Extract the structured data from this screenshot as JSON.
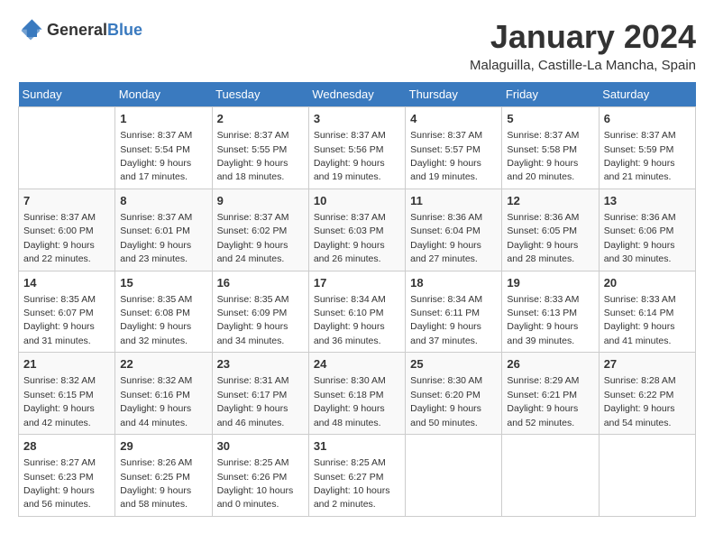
{
  "header": {
    "logo_line1": "General",
    "logo_line2": "Blue",
    "title": "January 2024",
    "subtitle": "Malaguilla, Castille-La Mancha, Spain"
  },
  "weekdays": [
    "Sunday",
    "Monday",
    "Tuesday",
    "Wednesday",
    "Thursday",
    "Friday",
    "Saturday"
  ],
  "weeks": [
    [
      {
        "day": "",
        "sunrise": "",
        "sunset": "",
        "daylight": ""
      },
      {
        "day": "1",
        "sunrise": "Sunrise: 8:37 AM",
        "sunset": "Sunset: 5:54 PM",
        "daylight": "Daylight: 9 hours and 17 minutes."
      },
      {
        "day": "2",
        "sunrise": "Sunrise: 8:37 AM",
        "sunset": "Sunset: 5:55 PM",
        "daylight": "Daylight: 9 hours and 18 minutes."
      },
      {
        "day": "3",
        "sunrise": "Sunrise: 8:37 AM",
        "sunset": "Sunset: 5:56 PM",
        "daylight": "Daylight: 9 hours and 19 minutes."
      },
      {
        "day": "4",
        "sunrise": "Sunrise: 8:37 AM",
        "sunset": "Sunset: 5:57 PM",
        "daylight": "Daylight: 9 hours and 19 minutes."
      },
      {
        "day": "5",
        "sunrise": "Sunrise: 8:37 AM",
        "sunset": "Sunset: 5:58 PM",
        "daylight": "Daylight: 9 hours and 20 minutes."
      },
      {
        "day": "6",
        "sunrise": "Sunrise: 8:37 AM",
        "sunset": "Sunset: 5:59 PM",
        "daylight": "Daylight: 9 hours and 21 minutes."
      }
    ],
    [
      {
        "day": "7",
        "sunrise": "Sunrise: 8:37 AM",
        "sunset": "Sunset: 6:00 PM",
        "daylight": "Daylight: 9 hours and 22 minutes."
      },
      {
        "day": "8",
        "sunrise": "Sunrise: 8:37 AM",
        "sunset": "Sunset: 6:01 PM",
        "daylight": "Daylight: 9 hours and 23 minutes."
      },
      {
        "day": "9",
        "sunrise": "Sunrise: 8:37 AM",
        "sunset": "Sunset: 6:02 PM",
        "daylight": "Daylight: 9 hours and 24 minutes."
      },
      {
        "day": "10",
        "sunrise": "Sunrise: 8:37 AM",
        "sunset": "Sunset: 6:03 PM",
        "daylight": "Daylight: 9 hours and 26 minutes."
      },
      {
        "day": "11",
        "sunrise": "Sunrise: 8:36 AM",
        "sunset": "Sunset: 6:04 PM",
        "daylight": "Daylight: 9 hours and 27 minutes."
      },
      {
        "day": "12",
        "sunrise": "Sunrise: 8:36 AM",
        "sunset": "Sunset: 6:05 PM",
        "daylight": "Daylight: 9 hours and 28 minutes."
      },
      {
        "day": "13",
        "sunrise": "Sunrise: 8:36 AM",
        "sunset": "Sunset: 6:06 PM",
        "daylight": "Daylight: 9 hours and 30 minutes."
      }
    ],
    [
      {
        "day": "14",
        "sunrise": "Sunrise: 8:35 AM",
        "sunset": "Sunset: 6:07 PM",
        "daylight": "Daylight: 9 hours and 31 minutes."
      },
      {
        "day": "15",
        "sunrise": "Sunrise: 8:35 AM",
        "sunset": "Sunset: 6:08 PM",
        "daylight": "Daylight: 9 hours and 32 minutes."
      },
      {
        "day": "16",
        "sunrise": "Sunrise: 8:35 AM",
        "sunset": "Sunset: 6:09 PM",
        "daylight": "Daylight: 9 hours and 34 minutes."
      },
      {
        "day": "17",
        "sunrise": "Sunrise: 8:34 AM",
        "sunset": "Sunset: 6:10 PM",
        "daylight": "Daylight: 9 hours and 36 minutes."
      },
      {
        "day": "18",
        "sunrise": "Sunrise: 8:34 AM",
        "sunset": "Sunset: 6:11 PM",
        "daylight": "Daylight: 9 hours and 37 minutes."
      },
      {
        "day": "19",
        "sunrise": "Sunrise: 8:33 AM",
        "sunset": "Sunset: 6:13 PM",
        "daylight": "Daylight: 9 hours and 39 minutes."
      },
      {
        "day": "20",
        "sunrise": "Sunrise: 8:33 AM",
        "sunset": "Sunset: 6:14 PM",
        "daylight": "Daylight: 9 hours and 41 minutes."
      }
    ],
    [
      {
        "day": "21",
        "sunrise": "Sunrise: 8:32 AM",
        "sunset": "Sunset: 6:15 PM",
        "daylight": "Daylight: 9 hours and 42 minutes."
      },
      {
        "day": "22",
        "sunrise": "Sunrise: 8:32 AM",
        "sunset": "Sunset: 6:16 PM",
        "daylight": "Daylight: 9 hours and 44 minutes."
      },
      {
        "day": "23",
        "sunrise": "Sunrise: 8:31 AM",
        "sunset": "Sunset: 6:17 PM",
        "daylight": "Daylight: 9 hours and 46 minutes."
      },
      {
        "day": "24",
        "sunrise": "Sunrise: 8:30 AM",
        "sunset": "Sunset: 6:18 PM",
        "daylight": "Daylight: 9 hours and 48 minutes."
      },
      {
        "day": "25",
        "sunrise": "Sunrise: 8:30 AM",
        "sunset": "Sunset: 6:20 PM",
        "daylight": "Daylight: 9 hours and 50 minutes."
      },
      {
        "day": "26",
        "sunrise": "Sunrise: 8:29 AM",
        "sunset": "Sunset: 6:21 PM",
        "daylight": "Daylight: 9 hours and 52 minutes."
      },
      {
        "day": "27",
        "sunrise": "Sunrise: 8:28 AM",
        "sunset": "Sunset: 6:22 PM",
        "daylight": "Daylight: 9 hours and 54 minutes."
      }
    ],
    [
      {
        "day": "28",
        "sunrise": "Sunrise: 8:27 AM",
        "sunset": "Sunset: 6:23 PM",
        "daylight": "Daylight: 9 hours and 56 minutes."
      },
      {
        "day": "29",
        "sunrise": "Sunrise: 8:26 AM",
        "sunset": "Sunset: 6:25 PM",
        "daylight": "Daylight: 9 hours and 58 minutes."
      },
      {
        "day": "30",
        "sunrise": "Sunrise: 8:25 AM",
        "sunset": "Sunset: 6:26 PM",
        "daylight": "Daylight: 10 hours and 0 minutes."
      },
      {
        "day": "31",
        "sunrise": "Sunrise: 8:25 AM",
        "sunset": "Sunset: 6:27 PM",
        "daylight": "Daylight: 10 hours and 2 minutes."
      },
      {
        "day": "",
        "sunrise": "",
        "sunset": "",
        "daylight": ""
      },
      {
        "day": "",
        "sunrise": "",
        "sunset": "",
        "daylight": ""
      },
      {
        "day": "",
        "sunrise": "",
        "sunset": "",
        "daylight": ""
      }
    ]
  ]
}
